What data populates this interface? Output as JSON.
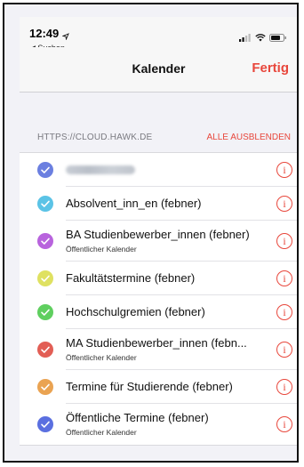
{
  "status": {
    "time": "12:49",
    "back_app": "◀ Suchen"
  },
  "nav": {
    "title": "Kalender",
    "done": "Fertig"
  },
  "section": {
    "title": "HTTPS://CLOUD.HAWK.DE",
    "hide_all": "ALLE AUSBLENDEN"
  },
  "calendars": [
    {
      "name": "",
      "subtitle": "",
      "color": "#6b7fe0",
      "blurred": true
    },
    {
      "name": "Absolvent_inn_en (febner)",
      "subtitle": "",
      "color": "#5bc3e6"
    },
    {
      "name": "BA Studienbewerber_innen (febner)",
      "subtitle": "Öffentlicher Kalender",
      "color": "#b863dd"
    },
    {
      "name": "Fakultätstermine (febner)",
      "subtitle": "",
      "color": "#dfe161"
    },
    {
      "name": "Hochschulgremien (febner)",
      "subtitle": "",
      "color": "#5fcf5f"
    },
    {
      "name": "MA Studienbewerber_innen (febn...",
      "subtitle": "Öffentlicher Kalender",
      "color": "#e25e55"
    },
    {
      "name": "Termine für Studierende (febner)",
      "subtitle": "",
      "color": "#eaa352"
    },
    {
      "name": "Öffentliche Termine (febner)",
      "subtitle": "Öffentlicher Kalender",
      "color": "#5a6fe0"
    }
  ],
  "icons": {
    "info": "info-icon",
    "check": "checkmark-icon"
  }
}
